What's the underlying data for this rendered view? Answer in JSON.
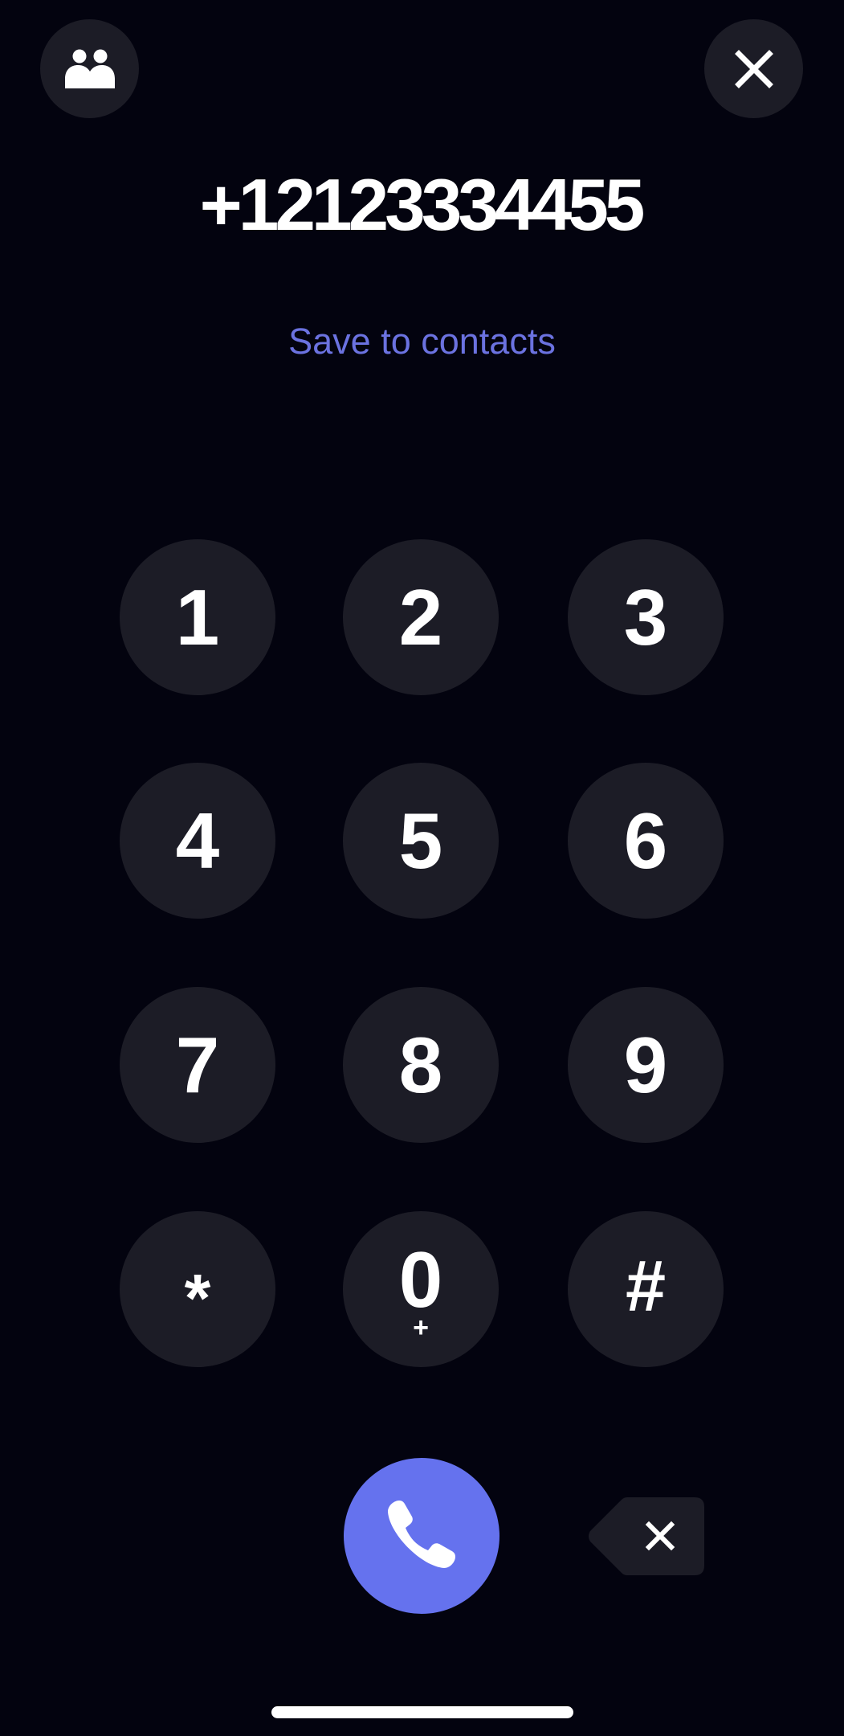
{
  "header": {
    "contacts_button": {
      "icon": "contacts-icon",
      "label": "Contacts"
    },
    "close_button": {
      "icon": "close-icon",
      "label": "Close"
    }
  },
  "dialer": {
    "number": "+12123334455",
    "save_link": "Save to contacts"
  },
  "keypad": {
    "keys": [
      {
        "digit": "1",
        "sub": ""
      },
      {
        "digit": "2",
        "sub": ""
      },
      {
        "digit": "3",
        "sub": ""
      },
      {
        "digit": "4",
        "sub": ""
      },
      {
        "digit": "5",
        "sub": ""
      },
      {
        "digit": "6",
        "sub": ""
      },
      {
        "digit": "7",
        "sub": ""
      },
      {
        "digit": "8",
        "sub": ""
      },
      {
        "digit": "9",
        "sub": ""
      },
      {
        "digit": "*",
        "sub": ""
      },
      {
        "digit": "0",
        "sub": "+"
      },
      {
        "digit": "#",
        "sub": ""
      }
    ]
  },
  "actions": {
    "call_button": {
      "icon": "phone-icon",
      "label": "Call"
    },
    "backspace_button": {
      "icon": "backspace-icon",
      "label": "Delete"
    }
  },
  "colors": {
    "background": "#03030f",
    "key_background": "#1c1c26",
    "accent": "#6572ee",
    "link": "#6b72e0",
    "text": "#ffffff"
  }
}
